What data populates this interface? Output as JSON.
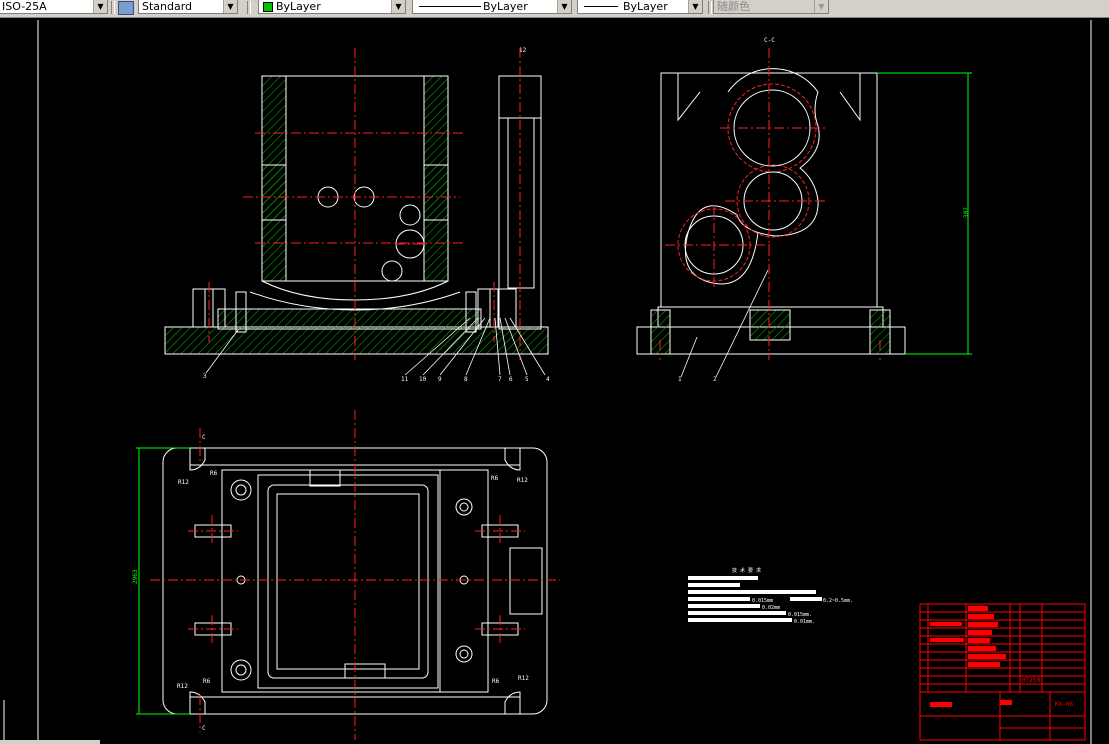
{
  "toolbar": {
    "layer_combo": "ISO-25A",
    "textstyle_combo": "Standard",
    "color_combo": "ByLayer",
    "linetype_combo": "ByLayer",
    "lineweight_combo": "ByLayer",
    "plotstyle_combo": "随颜色",
    "colors": {
      "layer_swatch": "#00c000"
    }
  },
  "drawing": {
    "section_label": "C-C",
    "part_label_top": "12",
    "dim_height": "307",
    "dim_width": "2963",
    "front_balloons": [
      "11",
      "10",
      "9",
      "8",
      "7",
      "6",
      "5",
      "4"
    ],
    "left_balloon": "3",
    "side_balloons": [
      "1",
      "2"
    ],
    "radius_labels": [
      "R12",
      "R6",
      "R6",
      "R12",
      "R12",
      "R6",
      "R6",
      "R12"
    ],
    "section_marks": [
      "C",
      "C"
    ],
    "notes": {
      "title": "技 术 要 求",
      "lines": [
        "0.015mm",
        "0.2~0.5mm.",
        "0.02mm",
        "0.015mm.",
        "0.01mm."
      ]
    },
    "title_block": {
      "drawing_code": "KX-06",
      "material": "HT250"
    },
    "colors": {
      "geometry": "#ffffff",
      "centerline": "#ff2020",
      "hatch": "#00c000",
      "dimension": "#00ff00",
      "title_block": "#ff0000"
    }
  }
}
